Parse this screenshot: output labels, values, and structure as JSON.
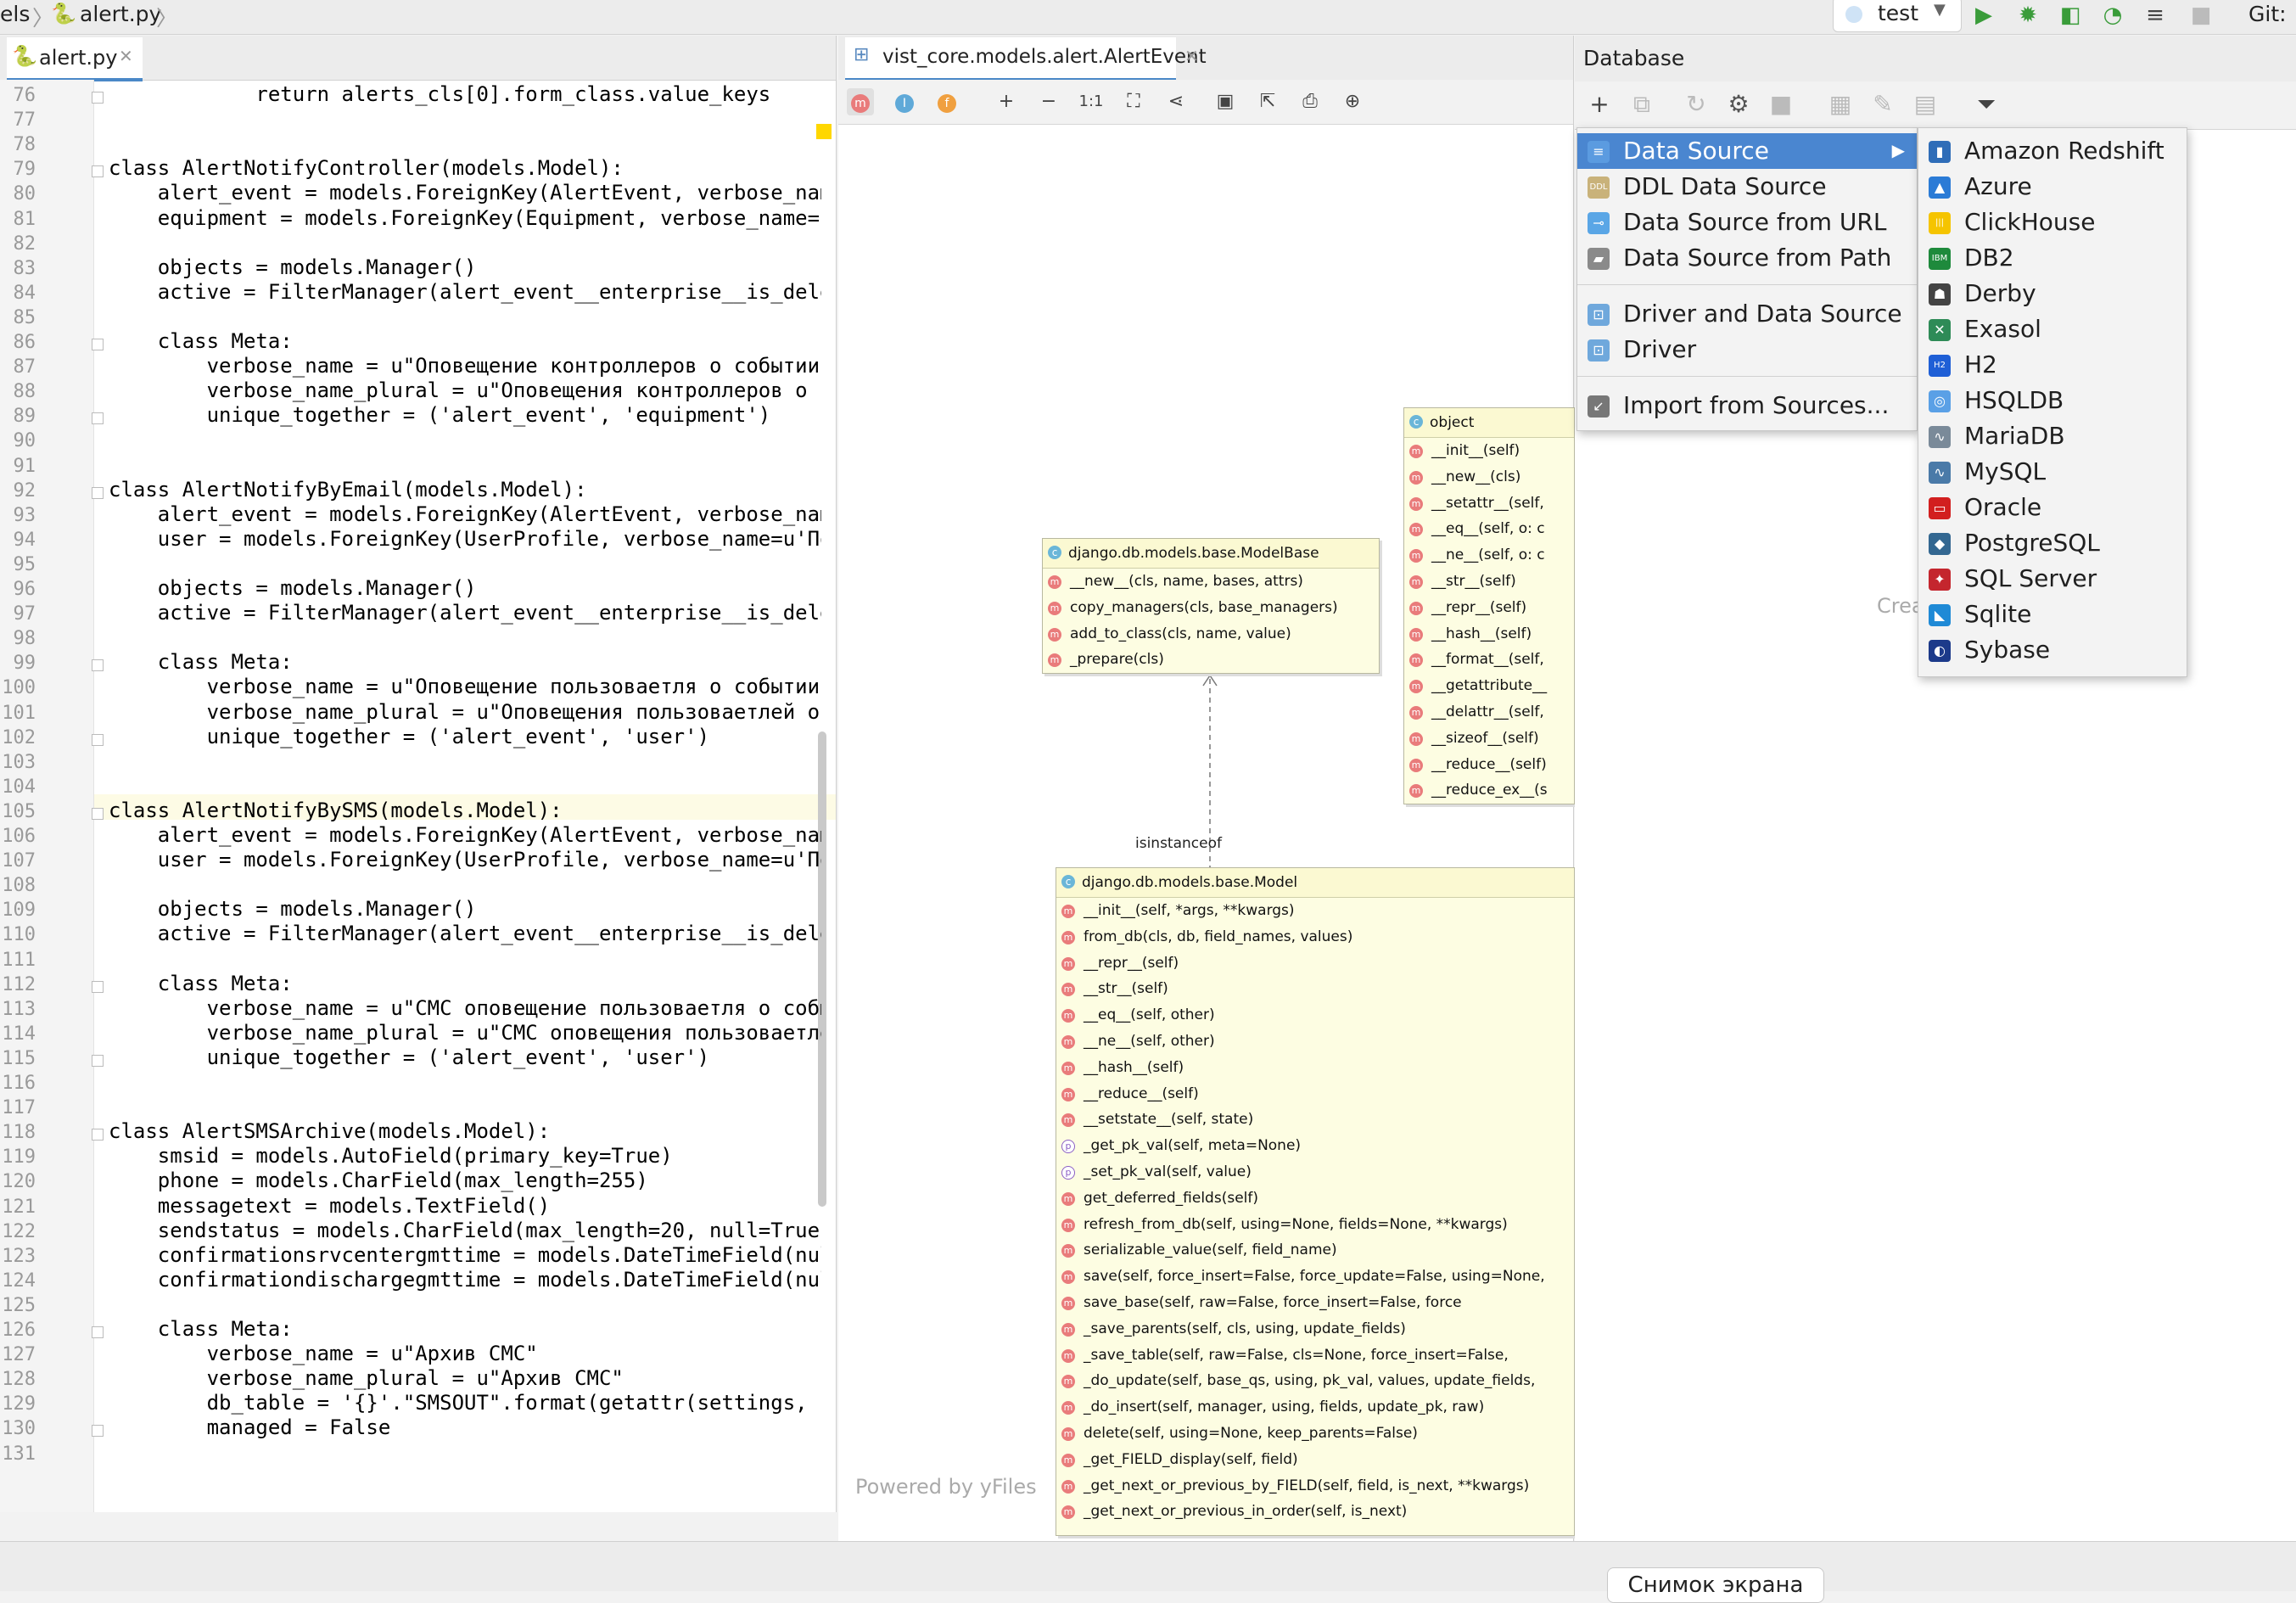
{
  "navbar": {
    "breadcrumb_prev": "els",
    "breadcrumb_file": "alert.py",
    "run_config": "test",
    "git_label": "Git:"
  },
  "editor": {
    "tab_label": "alert.py",
    "lines": [
      {
        "n": "76",
        "code": "            return alerts_cls[0].form_class.value_keys"
      },
      {
        "n": "77",
        "code": ""
      },
      {
        "n": "78",
        "code": ""
      },
      {
        "n": "79",
        "code": "class AlertNotifyController(models.Model):"
      },
      {
        "n": "80",
        "code": "    alert_event = models.ForeignKey(AlertEvent, verbose_name=u"
      },
      {
        "n": "81",
        "code": "    equipment = models.ForeignKey(Equipment, verbose_name=u'Об"
      },
      {
        "n": "82",
        "code": ""
      },
      {
        "n": "83",
        "code": "    objects = models.Manager()"
      },
      {
        "n": "84",
        "code": "    active = FilterManager(alert_event__enterprise__is_deleted"
      },
      {
        "n": "85",
        "code": ""
      },
      {
        "n": "86",
        "code": "    class Meta:"
      },
      {
        "n": "87",
        "code": "        verbose_name = u\"Оповещение контроллеров о событии\""
      },
      {
        "n": "88",
        "code": "        verbose_name_plural = u\"Оповещения контроллеров о собы"
      },
      {
        "n": "89",
        "code": "        unique_together = ('alert_event', 'equipment')"
      },
      {
        "n": "90",
        "code": ""
      },
      {
        "n": "91",
        "code": ""
      },
      {
        "n": "92",
        "code": "class AlertNotifyByEmail(models.Model):"
      },
      {
        "n": "93",
        "code": "    alert_event = models.ForeignKey(AlertEvent, verbose_name=u"
      },
      {
        "n": "94",
        "code": "    user = models.ForeignKey(UserProfile, verbose_name=u'Поль"
      },
      {
        "n": "95",
        "code": ""
      },
      {
        "n": "96",
        "code": "    objects = models.Manager()"
      },
      {
        "n": "97",
        "code": "    active = FilterManager(alert_event__enterprise__is_deleted"
      },
      {
        "n": "98",
        "code": ""
      },
      {
        "n": "99",
        "code": "    class Meta:"
      },
      {
        "n": "100",
        "code": "        verbose_name = u\"Оповещение пользоваетля о событии\""
      },
      {
        "n": "101",
        "code": "        verbose_name_plural = u\"Оповещения пользоваетлей о со"
      },
      {
        "n": "102",
        "code": "        unique_together = ('alert_event', 'user')"
      },
      {
        "n": "103",
        "code": ""
      },
      {
        "n": "104",
        "code": ""
      },
      {
        "n": "105",
        "code": "class AlertNotifyBySMS(models.Model):"
      },
      {
        "n": "106",
        "code": "    alert_event = models.ForeignKey(AlertEvent, verbose_name=u"
      },
      {
        "n": "107",
        "code": "    user = models.ForeignKey(UserProfile, verbose_name=u'Поль"
      },
      {
        "n": "108",
        "code": ""
      },
      {
        "n": "109",
        "code": "    objects = models.Manager()"
      },
      {
        "n": "110",
        "code": "    active = FilterManager(alert_event__enterprise__is_deleted"
      },
      {
        "n": "111",
        "code": ""
      },
      {
        "n": "112",
        "code": "    class Meta:"
      },
      {
        "n": "113",
        "code": "        verbose_name = u\"СМС оповещение пользоваетля о событи"
      },
      {
        "n": "114",
        "code": "        verbose_name_plural = u\"СМС оповещения пользоваетлей"
      },
      {
        "n": "115",
        "code": "        unique_together = ('alert_event', 'user')"
      },
      {
        "n": "116",
        "code": ""
      },
      {
        "n": "117",
        "code": ""
      },
      {
        "n": "118",
        "code": "class AlertSMSArchive(models.Model):"
      },
      {
        "n": "119",
        "code": "    smsid = models.AutoField(primary_key=True)"
      },
      {
        "n": "120",
        "code": "    phone = models.CharField(max_length=255)"
      },
      {
        "n": "121",
        "code": "    messagetext = models.TextField()"
      },
      {
        "n": "122",
        "code": "    sendstatus = models.CharField(max_length=20, null=True)"
      },
      {
        "n": "123",
        "code": "    confirmationsrvcentergmttime = models.DateTimeField(null="
      },
      {
        "n": "124",
        "code": "    confirmationdischargegmttime = models.DateTimeField(null="
      },
      {
        "n": "125",
        "code": ""
      },
      {
        "n": "126",
        "code": "    class Meta:"
      },
      {
        "n": "127",
        "code": "        verbose_name = u\"Архив СМС\""
      },
      {
        "n": "128",
        "code": "        verbose_name_plural = u\"Архив СМС\""
      },
      {
        "n": "129",
        "code": "        db_table = '{}'.\"SMSOUT\".format(getattr(settings, 'UMM"
      },
      {
        "n": "130",
        "code": "        managed = False"
      },
      {
        "n": "131",
        "code": ""
      }
    ]
  },
  "diagram": {
    "tab_label": "vist_core.models.alert.AlertEvent",
    "toolbar": [
      "m",
      "I",
      "f",
      "+",
      "−",
      "1:1",
      "⛶",
      "⋖",
      "▣",
      "⇱",
      "⎙",
      "⊕"
    ],
    "powered_by": "Powered by yFiles",
    "edge_label": "isinstanceof",
    "object_class": {
      "title": "object",
      "methods": [
        "__init__(self)",
        "__new__(cls)",
        "__setattr__(self,",
        "__eq__(self, o: c",
        "__ne__(self, o: c",
        "__str__(self)",
        "__repr__(self)",
        "__hash__(self)",
        "__format__(self,",
        "__getattribute__",
        "__delattr__(self,",
        "__sizeof__(self)",
        "__reduce__(self)",
        "__reduce_ex__(s"
      ]
    },
    "modelbase_class": {
      "title": "django.db.models.base.ModelBase",
      "methods": [
        "__new__(cls, name, bases, attrs)",
        "copy_managers(cls, base_managers)",
        "add_to_class(cls, name, value)",
        "_prepare(cls)"
      ]
    },
    "model_class": {
      "title": "django.db.models.base.Model",
      "methods": [
        {
          "badge": "m",
          "text": "__init__(self, *args, **kwargs)"
        },
        {
          "badge": "m",
          "text": "from_db(cls, db, field_names, values)"
        },
        {
          "badge": "m",
          "text": "__repr__(self)"
        },
        {
          "badge": "m",
          "text": "__str__(self)"
        },
        {
          "badge": "m",
          "text": "__eq__(self, other)"
        },
        {
          "badge": "m",
          "text": "__ne__(self, other)"
        },
        {
          "badge": "m",
          "text": "__hash__(self)"
        },
        {
          "badge": "m",
          "text": "__reduce__(self)"
        },
        {
          "badge": "m",
          "text": "__setstate__(self, state)"
        },
        {
          "badge": "p",
          "text": "_get_pk_val(self, meta=None)"
        },
        {
          "badge": "p",
          "text": "_set_pk_val(self, value)"
        },
        {
          "badge": "m",
          "text": "get_deferred_fields(self)"
        },
        {
          "badge": "m",
          "text": "refresh_from_db(self, using=None, fields=None, **kwargs)"
        },
        {
          "badge": "m",
          "text": "serializable_value(self, field_name)"
        },
        {
          "badge": "m",
          "text": "save(self, force_insert=False, force_update=False, using=None,"
        },
        {
          "badge": "m",
          "text": "save_base(self, raw=False, force_insert=False,            force"
        },
        {
          "badge": "m",
          "text": "_save_parents(self, cls, using, update_fields)"
        },
        {
          "badge": "m",
          "text": "_save_table(self, raw=False, cls=None, force_insert=False,"
        },
        {
          "badge": "m",
          "text": "_do_update(self, base_qs, using, pk_val, values, update_fields,"
        },
        {
          "badge": "m",
          "text": "_do_insert(self, manager, using, fields, update_pk, raw)"
        },
        {
          "badge": "m",
          "text": "delete(self, using=None, keep_parents=False)"
        },
        {
          "badge": "m",
          "text": "_get_FIELD_display(self, field)"
        },
        {
          "badge": "m",
          "text": "_get_next_or_previous_by_FIELD(self, field, is_next, **kwargs)"
        },
        {
          "badge": "m",
          "text": "_get_next_or_previous_in_order(self, is_next)"
        }
      ]
    }
  },
  "database": {
    "title": "Database",
    "hint": "Crea",
    "add_menu": [
      {
        "label": "Data Source",
        "icon": "database-icon",
        "selected": true,
        "submenu": true
      },
      {
        "label": "DDL Data Source",
        "icon": "ddl-icon"
      },
      {
        "label": "Data Source from URL",
        "icon": "url-plug-icon"
      },
      {
        "label": "Data Source from Path",
        "icon": "folder-icon"
      },
      {
        "label": "Driver and Data Source",
        "icon": "driver-icon"
      },
      {
        "label": "Driver",
        "icon": "driver-icon"
      },
      {
        "label": "Import from Sources...",
        "icon": "import-icon"
      }
    ],
    "sources": [
      {
        "label": "Amazon Redshift",
        "color": "#2f6db8",
        "glyph": "▮"
      },
      {
        "label": "Azure",
        "color": "#2b7bd6",
        "glyph": "▲"
      },
      {
        "label": "ClickHouse",
        "color": "#f5c400",
        "glyph": "|||"
      },
      {
        "label": "DB2",
        "color": "#1e8a3c",
        "glyph": "IBM"
      },
      {
        "label": "Derby",
        "color": "#444444",
        "glyph": "☗"
      },
      {
        "label": "Exasol",
        "color": "#2e8b57",
        "glyph": "✕"
      },
      {
        "label": "H2",
        "color": "#1f5fd6",
        "glyph": "H2"
      },
      {
        "label": "HSQLDB",
        "color": "#5aa0e6",
        "glyph": "◎"
      },
      {
        "label": "MariaDB",
        "color": "#7a8a99",
        "glyph": "∿"
      },
      {
        "label": "MySQL",
        "color": "#4a7aa8",
        "glyph": "∿"
      },
      {
        "label": "Oracle",
        "color": "#d21f1f",
        "glyph": "▭"
      },
      {
        "label": "PostgreSQL",
        "color": "#336791",
        "glyph": "◆"
      },
      {
        "label": "SQL Server",
        "color": "#c4262e",
        "glyph": "✦"
      },
      {
        "label": "Sqlite",
        "color": "#1f8ad6",
        "glyph": "◣"
      },
      {
        "label": "Sybase",
        "color": "#1c3a8a",
        "glyph": "◐"
      }
    ]
  },
  "statusbar": {
    "screenshot_button": "Снимок экрана"
  }
}
